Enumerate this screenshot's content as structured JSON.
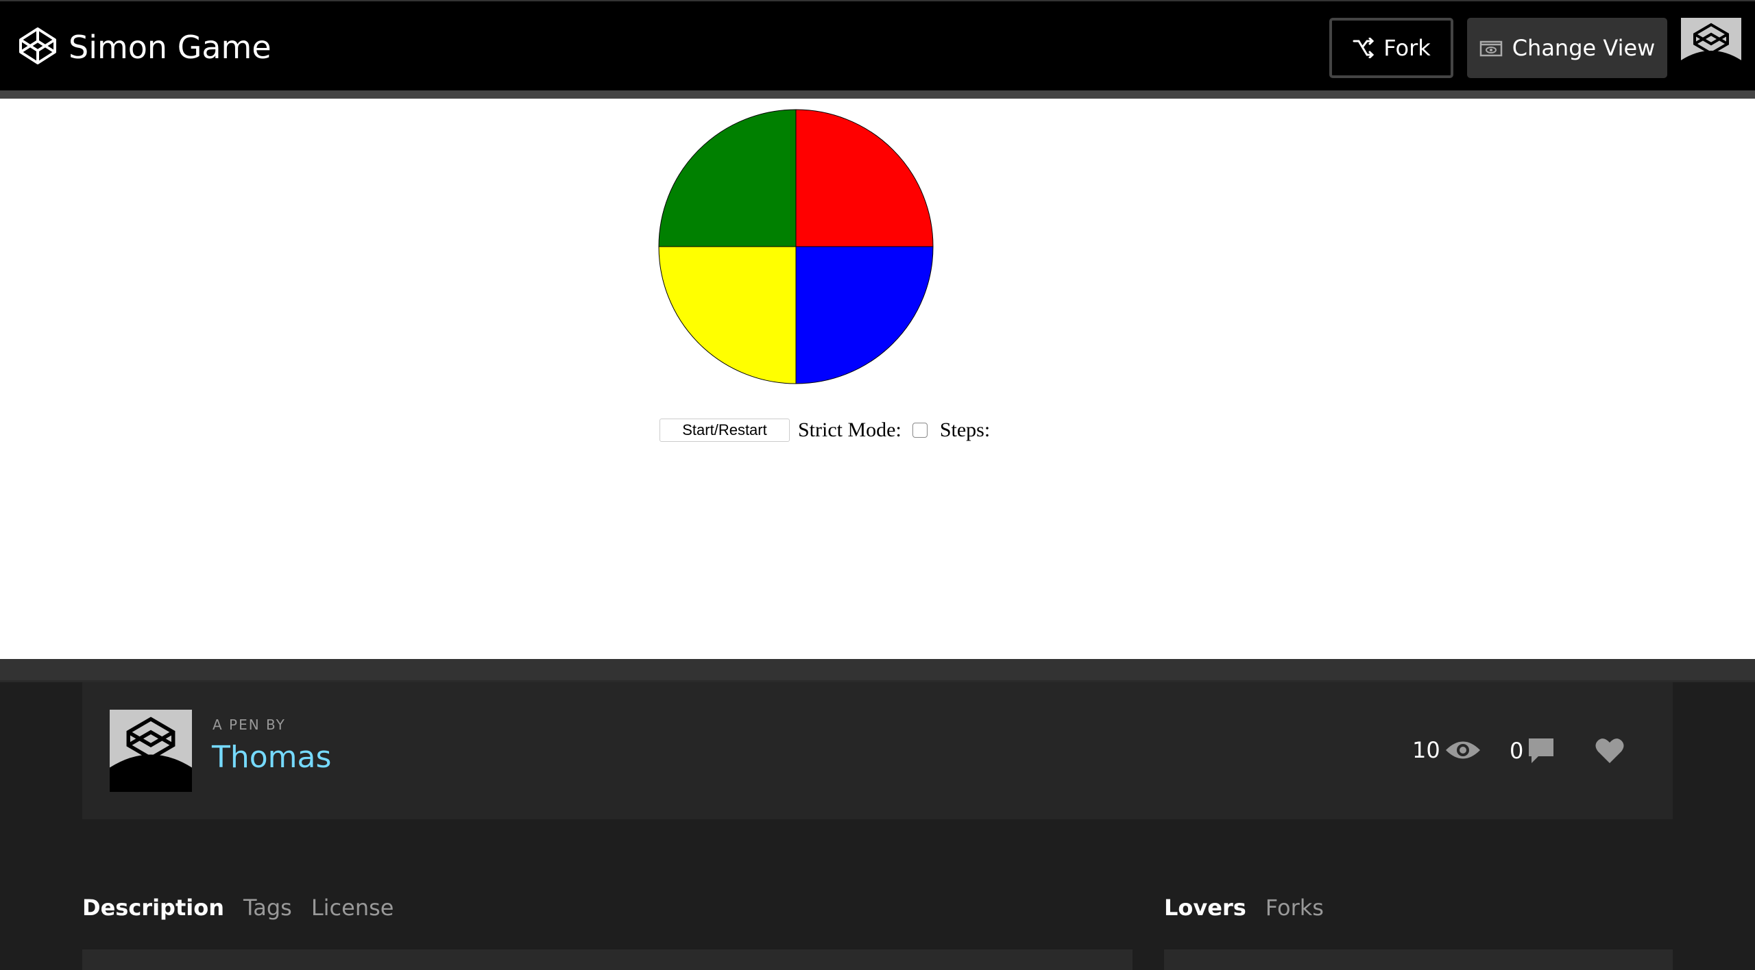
{
  "header": {
    "title": "Simon Game",
    "fork_label": "Fork",
    "change_view_label": "Change View"
  },
  "game": {
    "start_label": "Start/Restart",
    "strict_label": "Strict Mode:",
    "strict_checked": false,
    "steps_label": "Steps:",
    "quadrant_colors": {
      "top_left": "#008000",
      "top_right": "#ff0000",
      "bottom_left": "#ffff00",
      "bottom_right": "#0000ff"
    }
  },
  "pen": {
    "by_label": "A PEN BY",
    "author": "Thomas",
    "views": "10",
    "comments": "0"
  },
  "tabs_left": [
    "Description",
    "Tags",
    "License"
  ],
  "tabs_right": [
    "Lovers",
    "Forks"
  ],
  "icons": [
    "codepen-logo-icon",
    "fork-icon",
    "eye-box-icon",
    "avatar",
    "eye-icon",
    "comment-icon",
    "heart-icon"
  ]
}
